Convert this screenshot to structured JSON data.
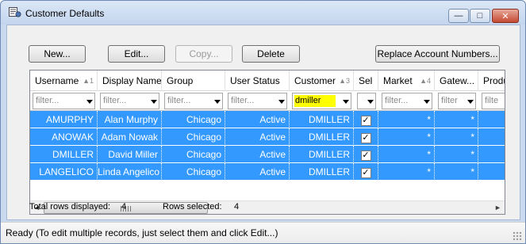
{
  "window": {
    "title": "Customer Defaults",
    "min_glyph": "—",
    "max_glyph": "□",
    "close_glyph": "✕"
  },
  "toolbar": {
    "new_label": "New...",
    "edit_label": "Edit...",
    "copy_label": "Copy...",
    "delete_label": "Delete",
    "replace_label": "Replace Account Numbers..."
  },
  "grid": {
    "columns": [
      {
        "label": "Username",
        "sort": "▲1"
      },
      {
        "label": "Display Name",
        "sort": ""
      },
      {
        "label": "Group",
        "sort": ""
      },
      {
        "label": "User Status",
        "sort": ""
      },
      {
        "label": "Customer",
        "sort": "▲3"
      },
      {
        "label": "Sel",
        "sort": ""
      },
      {
        "label": "Market",
        "sort": "▲4"
      },
      {
        "label": "Gatew...",
        "sort": ""
      },
      {
        "label": "Produ",
        "sort": ""
      }
    ],
    "filters": [
      "filter...",
      "filter...",
      "filter...",
      "filter...",
      "dmiller",
      "",
      "filter...",
      "filter",
      "filte"
    ],
    "rows": [
      {
        "username": "AMURPHY",
        "display_name": "Alan Murphy",
        "group": "Chicago",
        "status": "Active",
        "customer": "DMILLER",
        "sel": "✓",
        "market": "*",
        "gateway": "*"
      },
      {
        "username": "ANOWAK",
        "display_name": "Adam Nowak",
        "group": "Chicago",
        "status": "Active",
        "customer": "DMILLER",
        "sel": "✓",
        "market": "*",
        "gateway": "*"
      },
      {
        "username": "DMILLER",
        "display_name": "David Miller",
        "group": "Chicago",
        "status": "Active",
        "customer": "DMILLER",
        "sel": "✓",
        "market": "*",
        "gateway": "*"
      },
      {
        "username": "LANGELICO",
        "display_name": "Linda Angelico",
        "group": "Chicago",
        "status": "Active",
        "customer": "DMILLER",
        "sel": "✓",
        "market": "*",
        "gateway": "*"
      }
    ],
    "scroll_left_glyph": "◄",
    "scroll_right_glyph": "►"
  },
  "summary": {
    "total_label": "Total rows displayed:",
    "total_value": "4",
    "selected_label": "Rows selected:",
    "selected_value": "4"
  },
  "status_bar": {
    "text": "Ready (To edit multiple records, just select them and click Edit...)"
  },
  "colors": {
    "selection": "#3399ff",
    "active_filter": "#ffff00"
  }
}
